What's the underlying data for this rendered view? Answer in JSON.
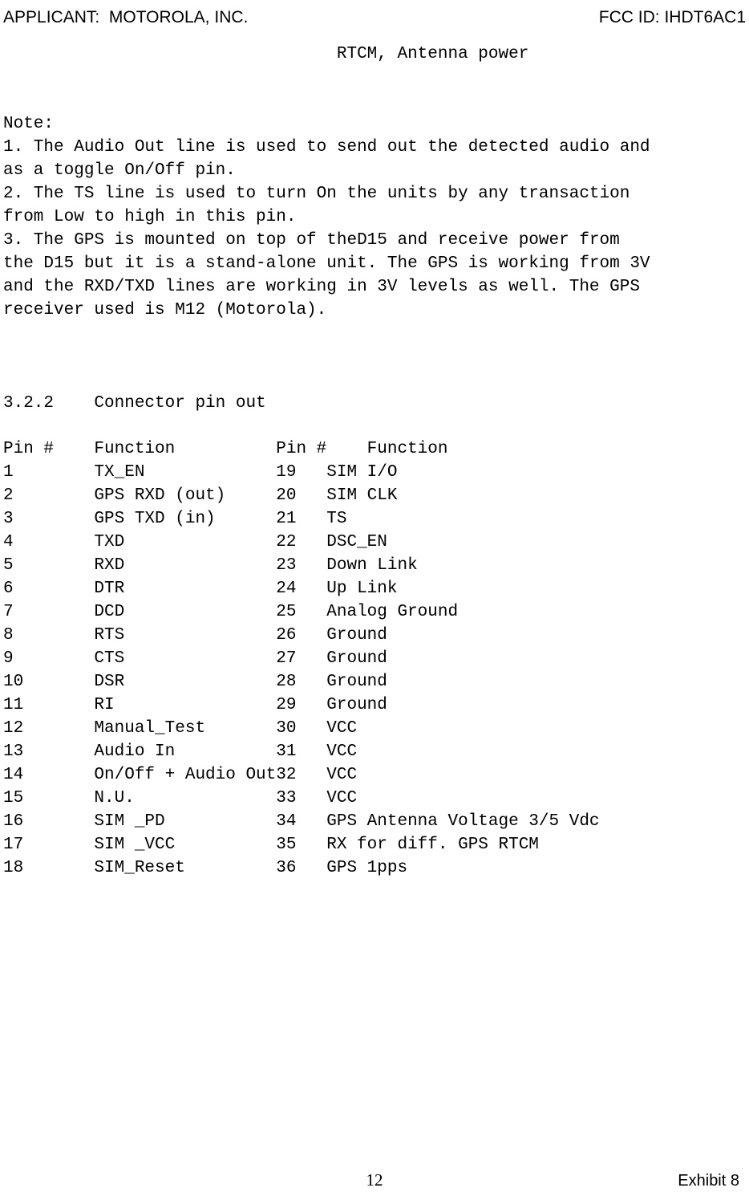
{
  "header": {
    "applicant_label": "APPLICANT:",
    "applicant_value": "MOTOROLA, INC.",
    "fcc_label": "FCC ID:",
    "fcc_value": "IHDT6AC1"
  },
  "rtcm_line": "RTCM, Antenna power",
  "note_heading": "Note:",
  "notes": [
    "1. The Audio Out line is used to send out the detected audio and as a toggle On/Off pin.",
    "2. The TS line is used to turn On the units by any transaction from Low to high in this pin.",
    "3. The GPS is mounted on top of theD15 and receive power from the D15 but it is a stand-alone unit. The GPS is working from 3V and the RXD/TXD lines are working in 3V levels as well. The GPS receiver used is M12 (Motorola)."
  ],
  "section": "3.2.2    Connector pin out",
  "table_header": {
    "col1": "Pin #",
    "col2": "Function",
    "col3": "Pin #",
    "col4": "Function"
  },
  "rows": [
    {
      "a": "1",
      "af": "TX_EN",
      "b": "19",
      "bf": "SIM I/O"
    },
    {
      "a": "2",
      "af": "GPS RXD (out)",
      "b": "20",
      "bf": "SIM CLK"
    },
    {
      "a": "3",
      "af": "GPS TXD (in)",
      "b": "21",
      "bf": "TS"
    },
    {
      "a": "4",
      "af": "TXD",
      "b": "22",
      "bf": "DSC_EN"
    },
    {
      "a": "5",
      "af": "RXD",
      "b": "23",
      "bf": "Down Link"
    },
    {
      "a": "6",
      "af": "DTR",
      "b": "24",
      "bf": "Up Link"
    },
    {
      "a": "7",
      "af": "DCD",
      "b": "25",
      "bf": "Analog Ground"
    },
    {
      "a": "8",
      "af": "RTS",
      "b": "26",
      "bf": "Ground"
    },
    {
      "a": "9",
      "af": "CTS",
      "b": "27",
      "bf": "Ground"
    },
    {
      "a": "10",
      "af": "DSR",
      "b": "28",
      "bf": "Ground"
    },
    {
      "a": "11",
      "af": "RI",
      "b": "29",
      "bf": "Ground"
    },
    {
      "a": "12",
      "af": "Manual_Test",
      "b": "30",
      "bf": "VCC"
    },
    {
      "a": "13",
      "af": "Audio In",
      "b": "31",
      "bf": "VCC"
    },
    {
      "a": "14",
      "af": "On/Off + Audio Out",
      "b": "32",
      "bf": "VCC"
    },
    {
      "a": "15",
      "af": "N.U.",
      "b": "33",
      "bf": "VCC"
    },
    {
      "a": "16",
      "af": "SIM _PD",
      "b": "34",
      "bf": "GPS Antenna Voltage 3/5 Vdc"
    },
    {
      "a": "17",
      "af": "SIM _VCC",
      "b": "35",
      "bf": "RX for diff. GPS RTCM"
    },
    {
      "a": "18",
      "af": "SIM_Reset",
      "b": "36",
      "bf": "GPS 1pps"
    }
  ],
  "footer": {
    "page": "12",
    "exhibit": "Exhibit 8"
  }
}
